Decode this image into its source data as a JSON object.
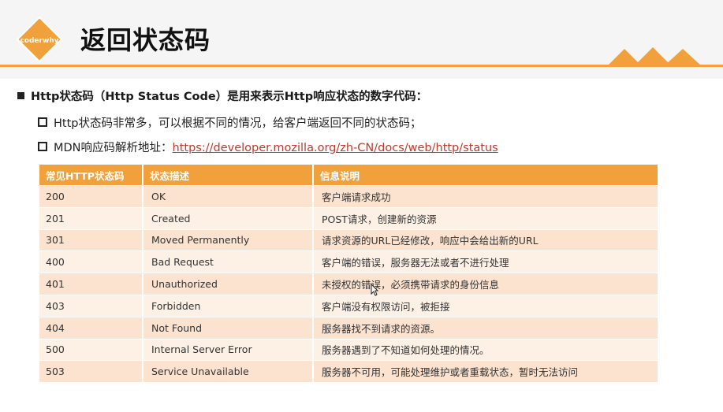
{
  "slide": {
    "logo_text": "coderwhy",
    "title": "返回状态码",
    "bullet_main": "Http状态码（Http Status Code）是用来表示Http响应状态的数字代码：",
    "sub_1": "Http状态码非常多，可以根据不同的情况，给客户端返回不同的状态码；",
    "sub_2_prefix": "MDN响应码解析地址：",
    "sub_2_link": "https://developer.mozilla.org/zh-CN/docs/web/http/status"
  },
  "table": {
    "headers": [
      "常见HTTP状态码",
      "状态描述",
      "信息说明"
    ],
    "rows": [
      [
        "200",
        "OK",
        "客户端请求成功"
      ],
      [
        "201",
        "Created",
        "POST请求，创建新的资源"
      ],
      [
        "301",
        "Moved Permanently",
        "请求资源的URL已经修改，响应中会给出新的URL"
      ],
      [
        "400",
        "Bad Request",
        "客户端的错误，服务器无法或者不进行处理"
      ],
      [
        "401",
        "Unauthorized",
        "未授权的错误，必须携带请求的身份信息"
      ],
      [
        "403",
        "Forbidden",
        "客户端没有权限访问，被拒接"
      ],
      [
        "404",
        "Not Found",
        "服务器找不到请求的资源。"
      ],
      [
        "500",
        "Internal Server Error",
        "服务器遇到了不知道如何处理的情况。"
      ],
      [
        "503",
        "Service Unavailable",
        "服务器不可用，可能处理维护或者重载状态，暂时无法访问"
      ]
    ]
  },
  "colors": {
    "accent": "#f0a13c",
    "row_odd": "#fbe3cf",
    "row_even": "#fdf1e6",
    "link": "#c0392b"
  },
  "icons": {
    "logo": "diamond-logo-icon",
    "decoration": "mountains-icon",
    "cursor": "mouse-cursor-icon"
  }
}
